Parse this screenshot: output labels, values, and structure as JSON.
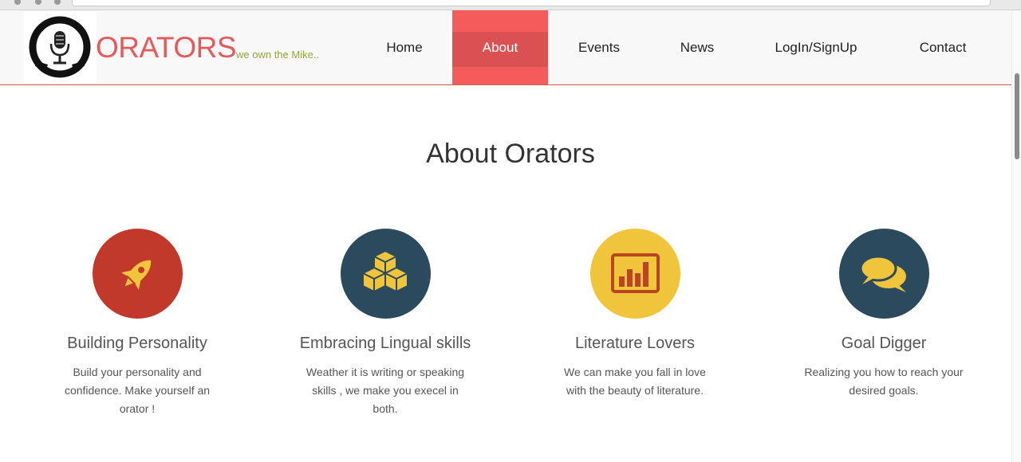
{
  "brand": {
    "name": "ORATORS",
    "tagline": "we own the Mike..",
    "logo_top_text": "ORATORS",
    "logo_bottom_text": "WE OWN THE MIKE"
  },
  "nav": [
    {
      "label": "Home",
      "active": false
    },
    {
      "label": "About",
      "active": true
    },
    {
      "label": "Events",
      "active": false
    },
    {
      "label": "News",
      "active": false
    },
    {
      "label": "LogIn/SignUp",
      "active": false
    },
    {
      "label": "Contact",
      "active": false
    }
  ],
  "about": {
    "title": "About Orators",
    "features": [
      {
        "title": "Building Personality",
        "text": "Build your personality and confidence. Make yourself an orator !",
        "icon": "rocket-icon",
        "color": "#c0392b"
      },
      {
        "title": "Embracing Lingual skills",
        "text": "Weather it is writing or speaking skills , we make you execel in both.",
        "icon": "cubes-icon",
        "color": "#2c4a5e"
      },
      {
        "title": "Literature Lovers",
        "text": "We can make you fall in love with the beauty of literature.",
        "icon": "bar-chart-icon",
        "color": "#f0c53b"
      },
      {
        "title": "Goal Digger",
        "text": "Realizing you how to reach your desired goals.",
        "icon": "chat-bubbles-icon",
        "color": "#2c4a5e"
      }
    ]
  },
  "colors": {
    "accent": "#f45b5b",
    "brand": "#e55a5a",
    "tagline": "#8fa83a",
    "icon_fill": "#f0c53b",
    "icon_dark": "#b8471f"
  }
}
